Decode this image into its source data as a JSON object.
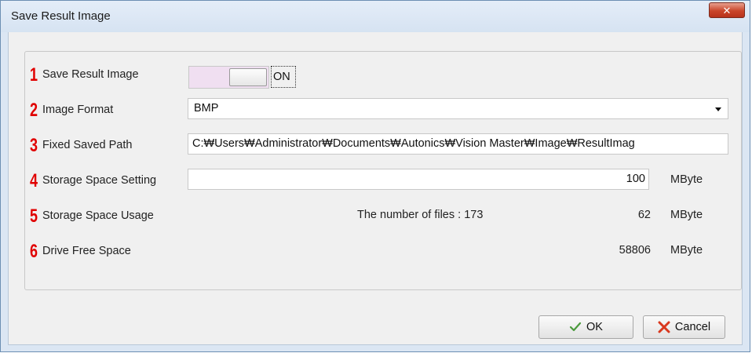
{
  "window": {
    "title": "Save Result Image"
  },
  "rows": [
    {
      "number": "1",
      "label": "Save Result Image",
      "toggle_state": "ON"
    },
    {
      "number": "2",
      "label": "Image Format",
      "value": "BMP"
    },
    {
      "number": "3",
      "label": "Fixed Saved Path",
      "value": "C:₩Users₩Administrator₩Documents₩Autonics₩Vision Master₩Image₩ResultImag"
    },
    {
      "number": "4",
      "label": "Storage Space Setting",
      "value": "100",
      "unit": "MByte"
    },
    {
      "number": "5",
      "label": "Storage Space Usage",
      "files_text": "The number of files : 173",
      "value": "62",
      "unit": "MByte"
    },
    {
      "number": "6",
      "label": "Drive Free Space",
      "value": "58806",
      "unit": "MByte"
    }
  ],
  "buttons": {
    "ok_label": "OK",
    "cancel_label": "Cancel"
  },
  "icons": {
    "close": "close-icon",
    "ok": "checkmark-icon",
    "cancel": "x-icon"
  },
  "colors": {
    "number_color": "#e00000",
    "toggle_background": "#f0dff1",
    "close_button": "#c9452a"
  }
}
